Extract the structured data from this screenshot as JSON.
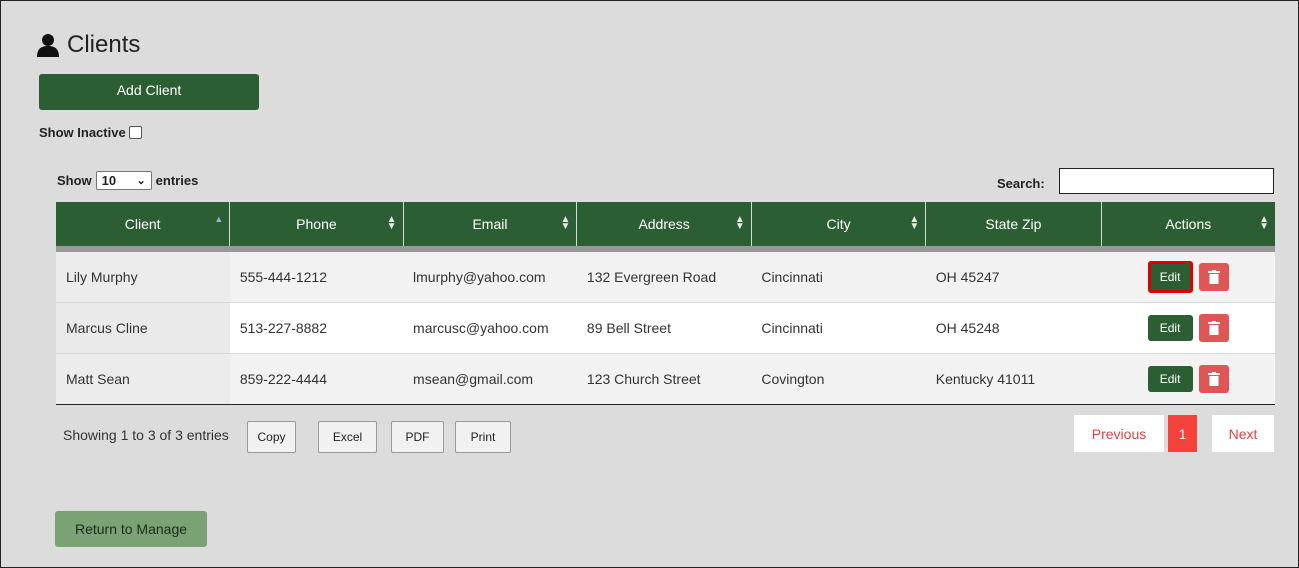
{
  "page": {
    "title": "Clients",
    "icon": "person-icon",
    "add_button": "Add Client",
    "show_inactive_label": "Show Inactive",
    "show_label": "Show",
    "entries_value": "10",
    "entries_label": "entries",
    "search_label": "Search:",
    "search_value": ""
  },
  "table": {
    "columns": [
      "Client",
      "Phone",
      "Email",
      "Address",
      "City",
      "State Zip",
      "Actions"
    ],
    "rows": [
      {
        "client": "Lily Murphy",
        "phone": "555-444-1212",
        "email": "lmurphy@yahoo.com",
        "address": "132 Evergreen Road",
        "city": "Cincinnati",
        "state_zip": "OH 45247",
        "edit": "Edit"
      },
      {
        "client": "Marcus Cline",
        "phone": "513-227-8882",
        "email": "marcusc@yahoo.com",
        "address": "89 Bell Street",
        "city": "Cincinnati",
        "state_zip": "OH 45248",
        "edit": "Edit"
      },
      {
        "client": "Matt Sean",
        "phone": "859-222-4444",
        "email": "msean@gmail.com",
        "address": "123 Church Street",
        "city": "Covington",
        "state_zip": "Kentucky 41011",
        "edit": "Edit"
      }
    ]
  },
  "footer": {
    "info": "Showing 1 to 3 of 3 entries",
    "copy": "Copy",
    "excel": "Excel",
    "pdf": "PDF",
    "print": "Print",
    "previous": "Previous",
    "page": "1",
    "next": "Next"
  },
  "return_button": "Return to Manage",
  "colors": {
    "primary_green": "#2b5f33",
    "delete_red": "#df5656",
    "pager_red": "#f4433c",
    "return_green": "#7aa274",
    "highlight": "#e00000"
  }
}
